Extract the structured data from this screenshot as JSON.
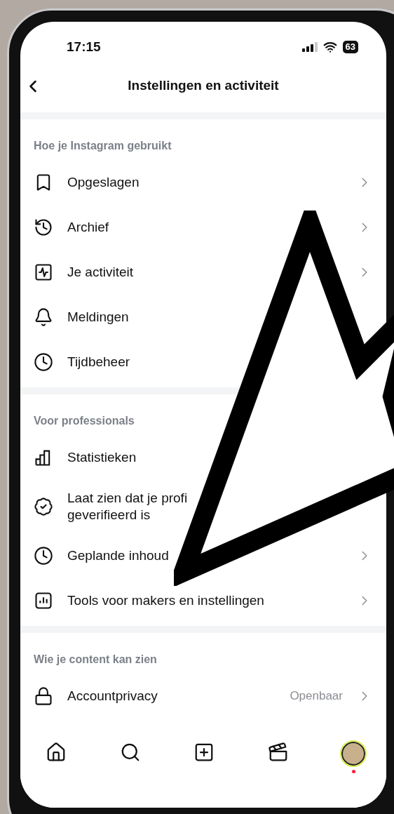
{
  "status_bar": {
    "time": "17:15",
    "battery": "63"
  },
  "header": {
    "title": "Instellingen en activiteit"
  },
  "sections": [
    {
      "heading": "Hoe je Instagram gebruikt",
      "items": [
        {
          "kind": "bookmark",
          "lines": [
            "Opgeslagen"
          ],
          "chevron": true
        },
        {
          "kind": "history",
          "lines": [
            "Archief"
          ],
          "chevron": true
        },
        {
          "kind": "activity",
          "lines": [
            "Je activiteit"
          ],
          "chevron": true
        },
        {
          "kind": "bell",
          "lines": [
            "Meldingen"
          ],
          "chevron": false
        },
        {
          "kind": "clock",
          "lines": [
            "Tijdbeheer"
          ],
          "chevron": false
        }
      ]
    },
    {
      "heading": "Voor professionals",
      "items": [
        {
          "kind": "chart",
          "lines": [
            "Statistieken"
          ],
          "chevron": false
        },
        {
          "kind": "verified",
          "lines": [
            "Laat zien dat je profi",
            "geverifieerd is"
          ],
          "chevron": false
        },
        {
          "kind": "clock",
          "lines": [
            "Geplande inhoud"
          ],
          "chevron": true
        },
        {
          "kind": "tools",
          "lines": [
            "Tools voor makers en instellingen"
          ],
          "chevron": true
        }
      ]
    },
    {
      "heading": "Wie je content kan zien",
      "items": [
        {
          "kind": "lock",
          "lines": [
            "Accountprivacy"
          ],
          "value": "Openbaar",
          "chevron": true
        }
      ]
    }
  ],
  "tab_bar": [
    {
      "kind": "home"
    },
    {
      "kind": "search"
    },
    {
      "kind": "create"
    },
    {
      "kind": "reels"
    },
    {
      "kind": "profile"
    }
  ]
}
